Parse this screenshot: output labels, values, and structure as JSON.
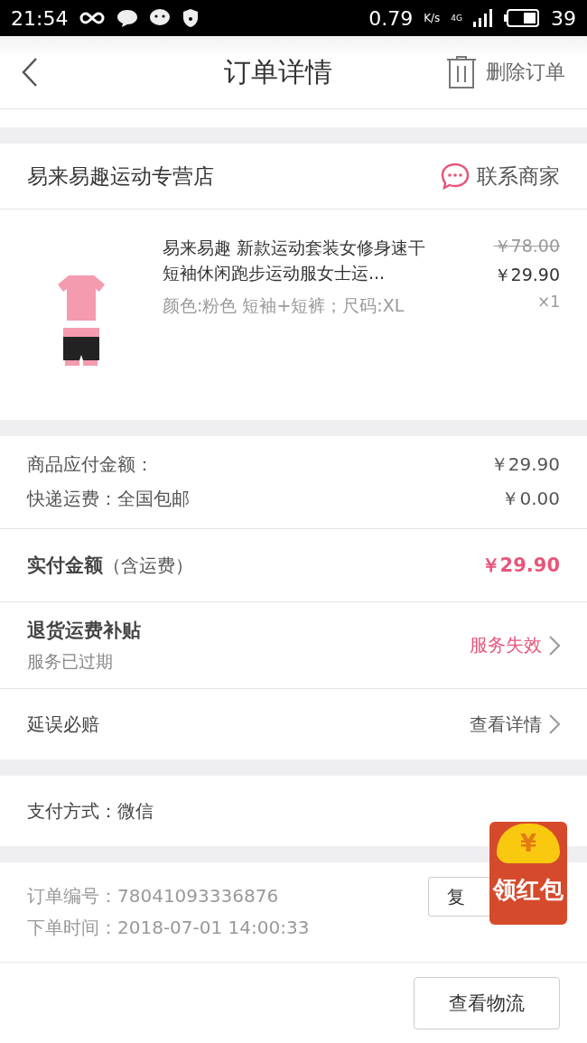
{
  "status_bar": {
    "time": "21:54",
    "speed": "0.79",
    "speed_unit": "K/s",
    "network": "4G",
    "battery": "39"
  },
  "header": {
    "title": "订单详情",
    "action": "删除订单"
  },
  "store": {
    "name": "易来易趣运动专营店",
    "contact": "联系商家"
  },
  "product": {
    "title": "易来易趣 新款运动套装女修身速干短袖休闲跑步运动服女士运...",
    "original_price": "￥78.00",
    "price": "￥29.90",
    "spec": "颜色:粉色  短袖+短裤；尺码:XL",
    "quantity": "×1"
  },
  "amounts": [
    {
      "label": "商品应付金额：",
      "value": "￥29.90"
    },
    {
      "label": "快递运费：全国包邮",
      "value": "￥0.00"
    }
  ],
  "total": {
    "label": "实付金额",
    "note": "（含运费）",
    "value": "￥29.90"
  },
  "links": [
    {
      "kind": "subsidy",
      "title": "退货运费补贴",
      "subtitle": "服务已过期",
      "action": "服务失效"
    },
    {
      "kind": "plain",
      "title": "延误必赔",
      "action": "查看详情"
    }
  ],
  "payment": {
    "text": "支付方式：微信"
  },
  "order_info": [
    {
      "label": "订单编号：",
      "value": "78041093336876"
    },
    {
      "label": "下单时间：",
      "value": "2018-07-01  14:00:33"
    }
  ],
  "copy_button": "复",
  "red_packet": {
    "label": "领红包",
    "symbol": "¥"
  },
  "bottom_button": "查看物流"
}
